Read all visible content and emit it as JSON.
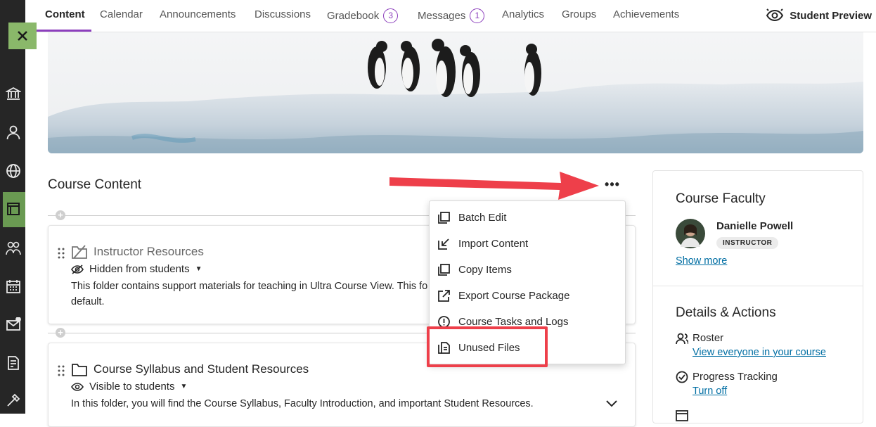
{
  "nav": {
    "tabs": [
      {
        "label": "Content"
      },
      {
        "label": "Calendar"
      },
      {
        "label": "Announcements"
      },
      {
        "label": "Discussions"
      },
      {
        "label": "Gradebook",
        "badge": "3"
      },
      {
        "label": "Messages",
        "badge": "1"
      },
      {
        "label": "Analytics"
      },
      {
        "label": "Groups"
      },
      {
        "label": "Achievements"
      }
    ],
    "student_preview": "Student Preview"
  },
  "course_content": {
    "title": "Course Content",
    "more_label": "•••"
  },
  "menu": {
    "items": [
      {
        "label": "Batch Edit",
        "icon": "batch-edit-icon"
      },
      {
        "label": "Import Content",
        "icon": "import-icon"
      },
      {
        "label": "Copy Items",
        "icon": "copy-icon"
      },
      {
        "label": "Export Course Package",
        "icon": "export-icon"
      },
      {
        "label": "Course Tasks and Logs",
        "icon": "alert-icon"
      },
      {
        "label": "Unused Files",
        "icon": "files-icon"
      }
    ]
  },
  "items": [
    {
      "title": "Instructor Resources",
      "visibility": "Hidden from students",
      "description_line1": "This folder contains support materials for teaching in Ultra Course View. This fo",
      "description_line2": "default."
    },
    {
      "title": "Course Syllabus and Student Resources",
      "visibility": "Visible to students",
      "description_line1": "In this folder, you will find the Course Syllabus, Faculty Introduction, and important Student Resources."
    }
  ],
  "faculty": {
    "heading": "Course Faculty",
    "name": "Danielle Powell",
    "role": "INSTRUCTOR",
    "show_more": "Show more"
  },
  "details": {
    "heading": "Details & Actions",
    "roster_label": "Roster",
    "roster_link": "View everyone in your course",
    "progress_label": "Progress Tracking",
    "progress_link": "Turn off"
  },
  "colors": {
    "accent": "#8c3fbd",
    "highlight": "#ee3f4a",
    "link": "#006ea3",
    "rail": "#262626",
    "rail_active": "#6a9a52"
  }
}
